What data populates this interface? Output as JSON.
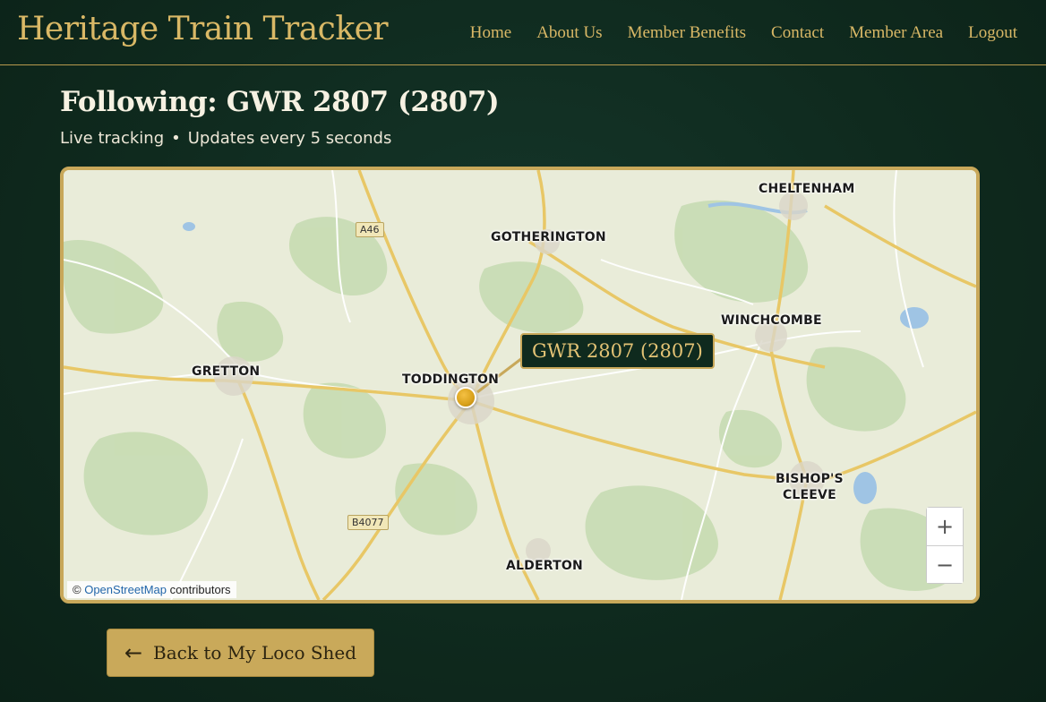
{
  "header": {
    "brand": "Heritage Train Tracker",
    "nav": [
      "Home",
      "About Us",
      "Member Benefits",
      "Contact",
      "Member Area",
      "Logout"
    ]
  },
  "page": {
    "title": "Following: GWR 2807 (2807)",
    "status": "Live tracking",
    "separator": "•",
    "updates": "Updates every 5 seconds"
  },
  "map": {
    "towns": {
      "cheltenham": "CHELTENHAM",
      "gotherington": "GOTHERINGTON",
      "winchcombe": "WINCHCOMBE",
      "gretton": "GRETTON",
      "toddington": "TODDINGTON",
      "bishops_cleeve": "BISHOP'S\nCLEEVE",
      "alderton": "ALDERTON"
    },
    "roads": {
      "a46": "A46",
      "b4077": "B4077"
    },
    "loco_label": "GWR 2807 (2807)",
    "zoom_in": "+",
    "zoom_out": "−",
    "attribution_prefix": "©",
    "attribution_link": "OpenStreetMap",
    "attribution_suffix": "contributors",
    "colors": {
      "land": "#e9ecd9",
      "woods": "#c7dcb2",
      "water": "#9fc4e4",
      "roads": "#e8c766"
    }
  },
  "actions": {
    "back_arrow": "←",
    "back_label": "Back to My Loco Shed"
  },
  "colors": {
    "background": "#0f2a1e",
    "gold": "#d9b866",
    "button": "#c9a95a"
  }
}
